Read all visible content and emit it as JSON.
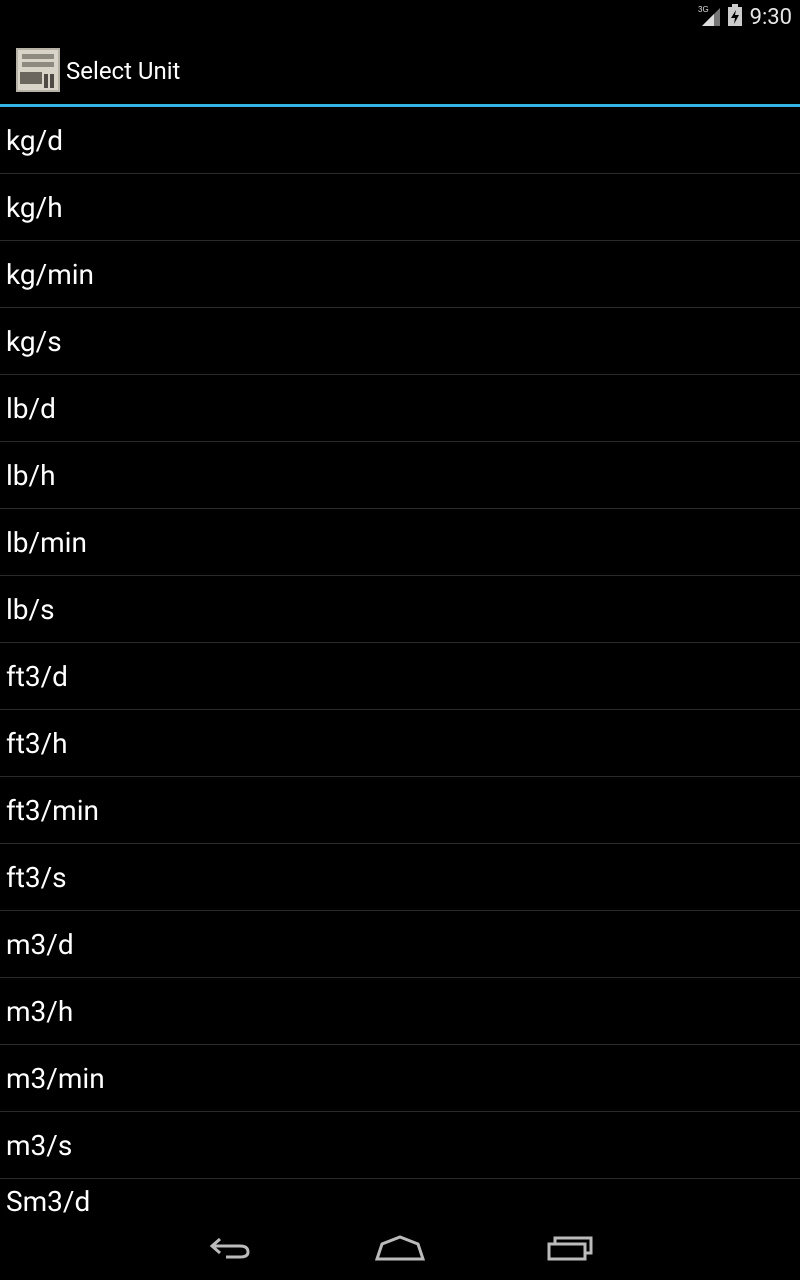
{
  "status_bar": {
    "network": "3G",
    "time": "9:30",
    "icons": [
      "signal-3g-icon",
      "battery-charging-icon"
    ]
  },
  "action_bar": {
    "app_icon": "converter-app-icon",
    "title": "Select Unit"
  },
  "accent_color": "#33b5e5",
  "units": [
    "kg/d",
    "kg/h",
    "kg/min",
    "kg/s",
    "lb/d",
    "lb/h",
    "lb/min",
    "lb/s",
    "ft3/d",
    "ft3/h",
    "ft3/min",
    "ft3/s",
    "m3/d",
    "m3/h",
    "m3/min",
    "m3/s",
    "Sm3/d"
  ],
  "nav_bar": {
    "icons": [
      "back-icon",
      "home-icon",
      "recent-apps-icon"
    ]
  }
}
